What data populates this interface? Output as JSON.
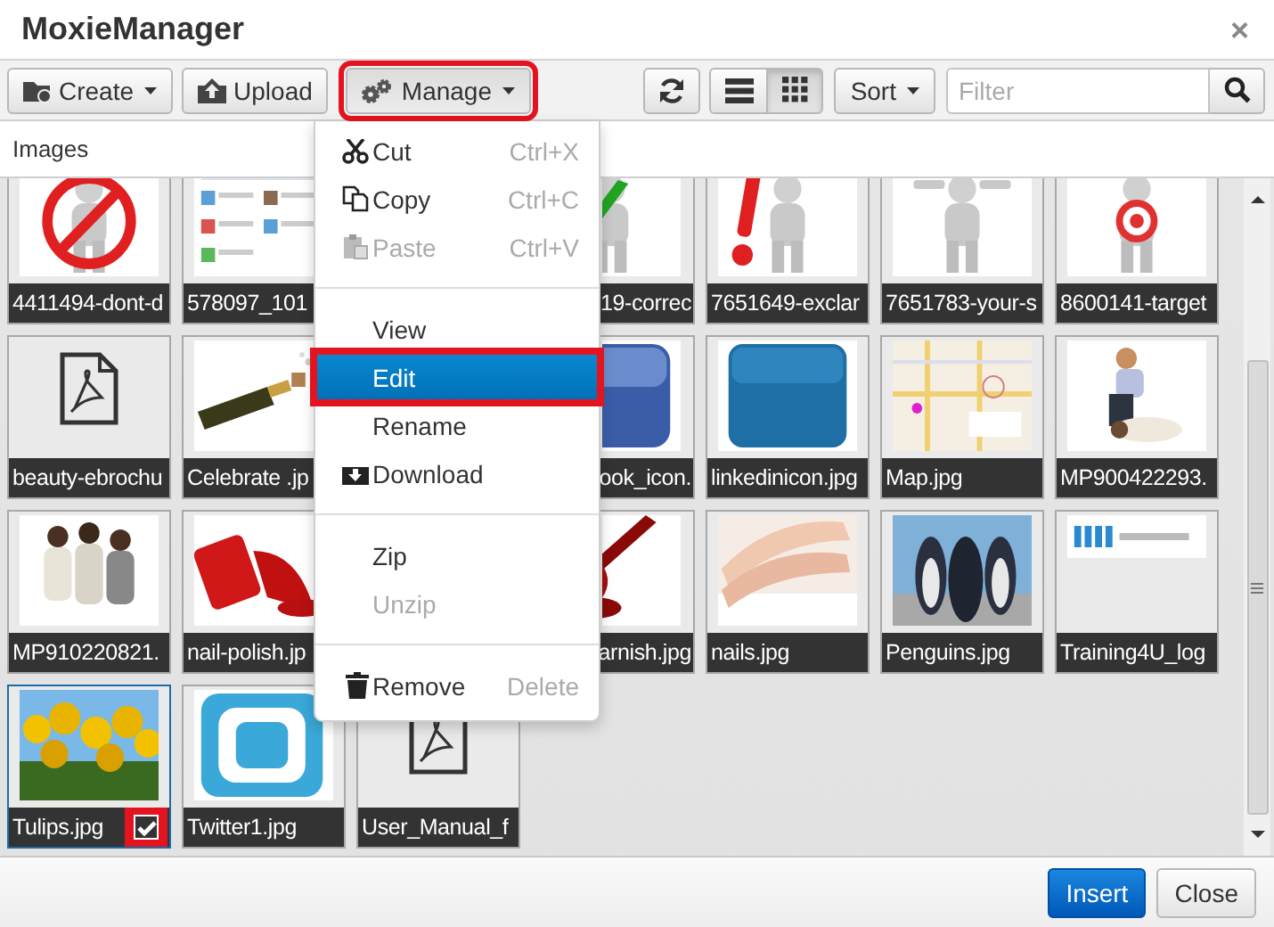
{
  "window": {
    "title": "MoxieManager",
    "close": "×"
  },
  "toolbar": {
    "left": [
      {
        "label": "Create",
        "dropdown": true,
        "highlighted": false
      },
      {
        "label": "Upload",
        "dropdown": false,
        "highlighted": false
      },
      {
        "label": "Manage",
        "dropdown": true,
        "highlighted": true
      }
    ],
    "views": [
      {
        "kind": "list",
        "selected": false
      },
      {
        "kind": "grid",
        "selected": true
      }
    ],
    "sort": {
      "label": "Sort"
    },
    "filter": {
      "placeholder": "Filter"
    }
  },
  "path": "Images",
  "rows": [
    [
      {
        "kind": "picture",
        "label": "4411494-dont-d",
        "selected": false,
        "highlighted": false
      },
      {
        "kind": "picture",
        "label": "578097_101",
        "selected": false,
        "highlighted": false
      },
      {
        "kind": "covered"
      },
      {
        "kind": "partial",
        "label": "19-correc",
        "selected": false,
        "highlighted": false
      },
      {
        "kind": "picture",
        "label": "7651649-exclar",
        "selected": false,
        "highlighted": false
      },
      {
        "kind": "picture",
        "label": "7651783-your-s",
        "selected": false,
        "highlighted": false
      },
      {
        "kind": "picture",
        "label": "8600141-target",
        "selected": false,
        "highlighted": false
      }
    ],
    [
      {
        "kind": "document",
        "label": "beauty-ebrochu",
        "selected": false,
        "highlighted": false
      },
      {
        "kind": "picture",
        "label": "Celebrate .jp",
        "selected": false,
        "highlighted": false
      },
      {
        "kind": "covered"
      },
      {
        "kind": "partial",
        "label": "ook_icon.",
        "selected": false,
        "highlighted": false
      },
      {
        "kind": "picture",
        "label": "linkedinicon.jpg",
        "selected": false,
        "highlighted": false
      },
      {
        "kind": "picture",
        "label": "Map.jpg",
        "selected": false,
        "highlighted": false
      },
      {
        "kind": "picture",
        "label": "MP900422293.",
        "selected": false,
        "highlighted": false
      }
    ],
    [
      {
        "kind": "picture",
        "label": "MP910220821.",
        "selected": false,
        "highlighted": false
      },
      {
        "kind": "picture",
        "label": "nail-polish.jp",
        "selected": false,
        "highlighted": false
      },
      {
        "kind": "covered"
      },
      {
        "kind": "partial",
        "label": "arnish.jpg",
        "selected": false,
        "highlighted": false
      },
      {
        "kind": "picture",
        "label": "nails.jpg",
        "selected": false,
        "highlighted": false
      },
      {
        "kind": "picture",
        "label": "Penguins.jpg",
        "selected": false,
        "highlighted": false
      },
      {
        "kind": "picture",
        "label": "Training4U_log",
        "selected": false,
        "highlighted": false
      }
    ],
    [
      {
        "kind": "picture",
        "label": "Tulips.jpg",
        "selected": true,
        "highlighted": true
      },
      {
        "kind": "picture",
        "label": "Twitter1.jpg",
        "selected": false,
        "highlighted": false
      },
      {
        "kind": "document",
        "label": "User_Manual_f",
        "selected": false,
        "highlighted": false
      }
    ]
  ],
  "menu": {
    "items": [
      {
        "kind": "item",
        "label": "Cut",
        "shortcut": "Ctrl+X",
        "disabled": false,
        "selected": false,
        "highlighted": false
      },
      {
        "kind": "item",
        "label": "Copy",
        "shortcut": "Ctrl+C",
        "disabled": false,
        "selected": false,
        "highlighted": false
      },
      {
        "kind": "item",
        "label": "Paste",
        "shortcut": "Ctrl+V",
        "disabled": true,
        "selected": false,
        "highlighted": false
      },
      {
        "kind": "separator"
      },
      {
        "kind": "item",
        "label": "View",
        "disabled": false,
        "selected": false,
        "highlighted": false
      },
      {
        "kind": "item",
        "label": "Edit",
        "disabled": false,
        "selected": true,
        "highlighted": true
      },
      {
        "kind": "item",
        "label": "Rename",
        "disabled": false,
        "selected": false,
        "highlighted": false
      },
      {
        "kind": "item",
        "label": "Download",
        "disabled": false,
        "selected": false,
        "highlighted": false
      },
      {
        "kind": "separator"
      },
      {
        "kind": "item",
        "label": "Zip",
        "disabled": false,
        "selected": false,
        "highlighted": false
      },
      {
        "kind": "item",
        "label": "Unzip",
        "disabled": true,
        "selected": false,
        "highlighted": false
      },
      {
        "kind": "separator"
      },
      {
        "kind": "item",
        "label": "Remove",
        "shortcut": "Delete",
        "disabled": false,
        "selected": false,
        "highlighted": false
      }
    ]
  },
  "footer": {
    "buttons": [
      {
        "label": "Insert",
        "kind": "primary"
      },
      {
        "label": "Close",
        "kind": "default"
      }
    ]
  }
}
